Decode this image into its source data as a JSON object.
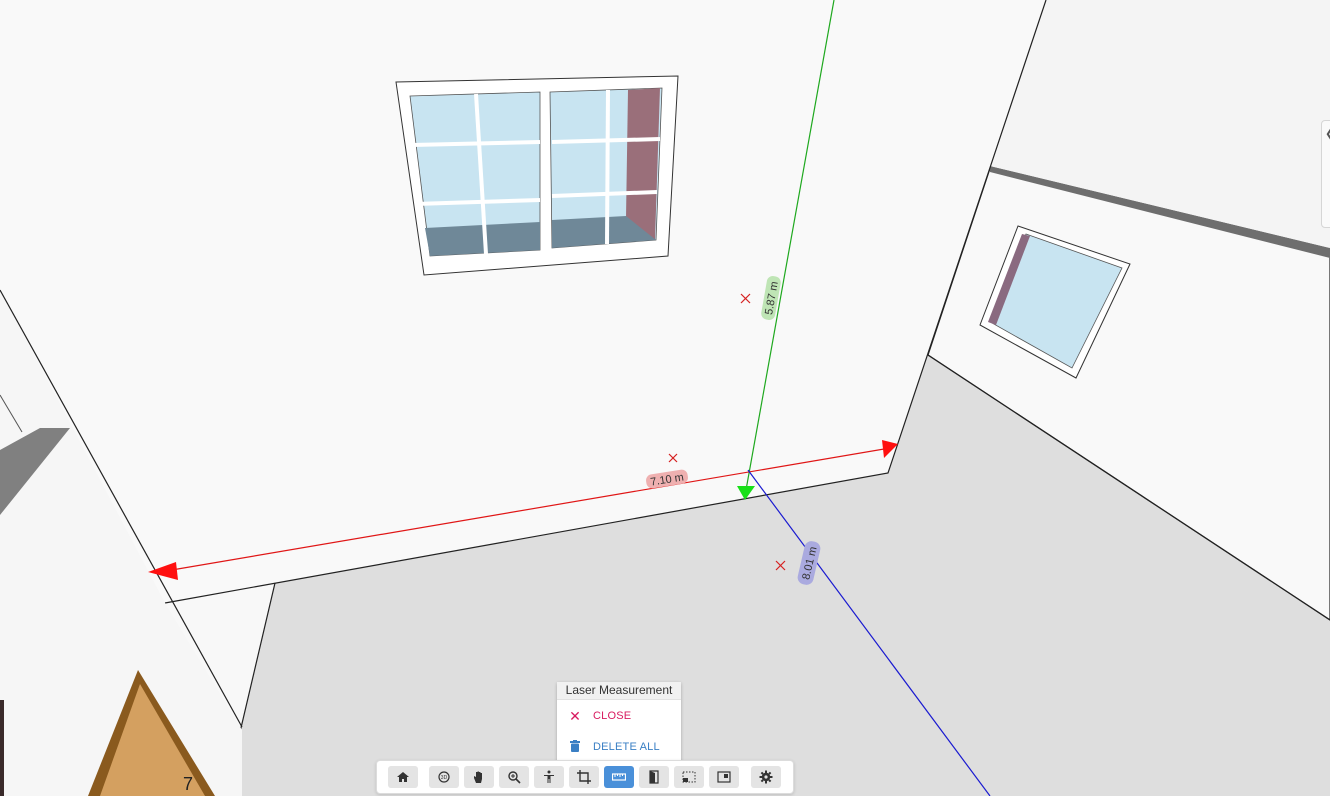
{
  "measurements": [
    {
      "id": "height",
      "label": "5.87 m",
      "color": "#1ea81e",
      "badge": "#bfe5b5"
    },
    {
      "id": "width",
      "label": "7.10 m",
      "color": "#e01616",
      "badge": "#efb0b0"
    },
    {
      "id": "depth",
      "label": "8.01 m",
      "color": "#1a1ad0",
      "badge": "#aaaadf"
    }
  ],
  "laser_panel": {
    "title": "Laser Measurement",
    "close_label": "CLOSE",
    "delete_all_label": "DELETE ALL",
    "close_color": "#d81b60",
    "delete_color": "#3a7fc4"
  },
  "toolbar": {
    "active_color": "#4a90d9",
    "buttons": [
      {
        "icon": "home-icon",
        "active": false
      },
      {
        "icon": "rotate-3d-icon",
        "active": false
      },
      {
        "icon": "pan-hand-icon",
        "active": false
      },
      {
        "icon": "zoom-icon",
        "active": false
      },
      {
        "icon": "walk-person-icon",
        "active": false
      },
      {
        "icon": "crop-icon",
        "active": false
      },
      {
        "icon": "ruler-icon",
        "active": true
      },
      {
        "icon": "door-icon",
        "active": false
      },
      {
        "icon": "section-box-icon",
        "active": false
      },
      {
        "icon": "picture-in-picture-icon",
        "active": false
      },
      {
        "icon": "gear-icon",
        "active": false
      }
    ]
  },
  "side_tab": {
    "icon": "chevron-left-icon"
  }
}
